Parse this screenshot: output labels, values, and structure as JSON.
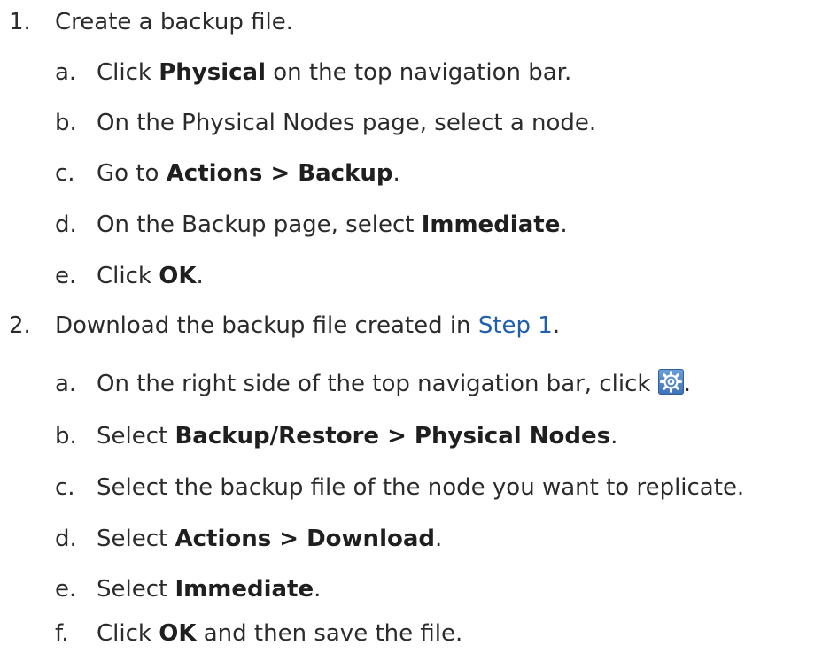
{
  "steps": [
    {
      "number": "1.",
      "text": "Create a backup file.",
      "substeps": [
        {
          "letter": "a.",
          "parts": [
            "Click ",
            "Physical",
            " on the top navigation bar."
          ]
        },
        {
          "letter": "b.",
          "text": "On the Physical Nodes page, select a node."
        },
        {
          "letter": "c.",
          "parts": [
            "Go to ",
            "Actions > Backup",
            "."
          ]
        },
        {
          "letter": "d.",
          "parts": [
            "On the Backup page, select ",
            "Immediate",
            "."
          ]
        },
        {
          "letter": "e.",
          "parts": [
            "Click ",
            "OK",
            "."
          ]
        }
      ]
    },
    {
      "number": "2.",
      "parts": [
        "Download the backup file created in ",
        "Step 1",
        "."
      ],
      "substeps": [
        {
          "letter": "a.",
          "parts": [
            "On the right side of the top navigation bar, click ",
            "."
          ],
          "icon": "gear-settings-icon"
        },
        {
          "letter": "b.",
          "parts": [
            "Select ",
            "Backup/Restore > Physical Nodes",
            "."
          ]
        },
        {
          "letter": "c.",
          "text": "Select the backup file of the node you want to replicate."
        },
        {
          "letter": "d.",
          "parts": [
            "Select ",
            "Actions > Download",
            "."
          ]
        },
        {
          "letter": "e.",
          "parts": [
            "Select ",
            "Immediate",
            "."
          ]
        },
        {
          "letter": "f.",
          "parts": [
            "Click ",
            "OK",
            " and then save the file."
          ]
        }
      ]
    }
  ],
  "colors": {
    "text": "#2b2b2b",
    "link": "#1f5fae",
    "icon": "#4a80c4"
  }
}
